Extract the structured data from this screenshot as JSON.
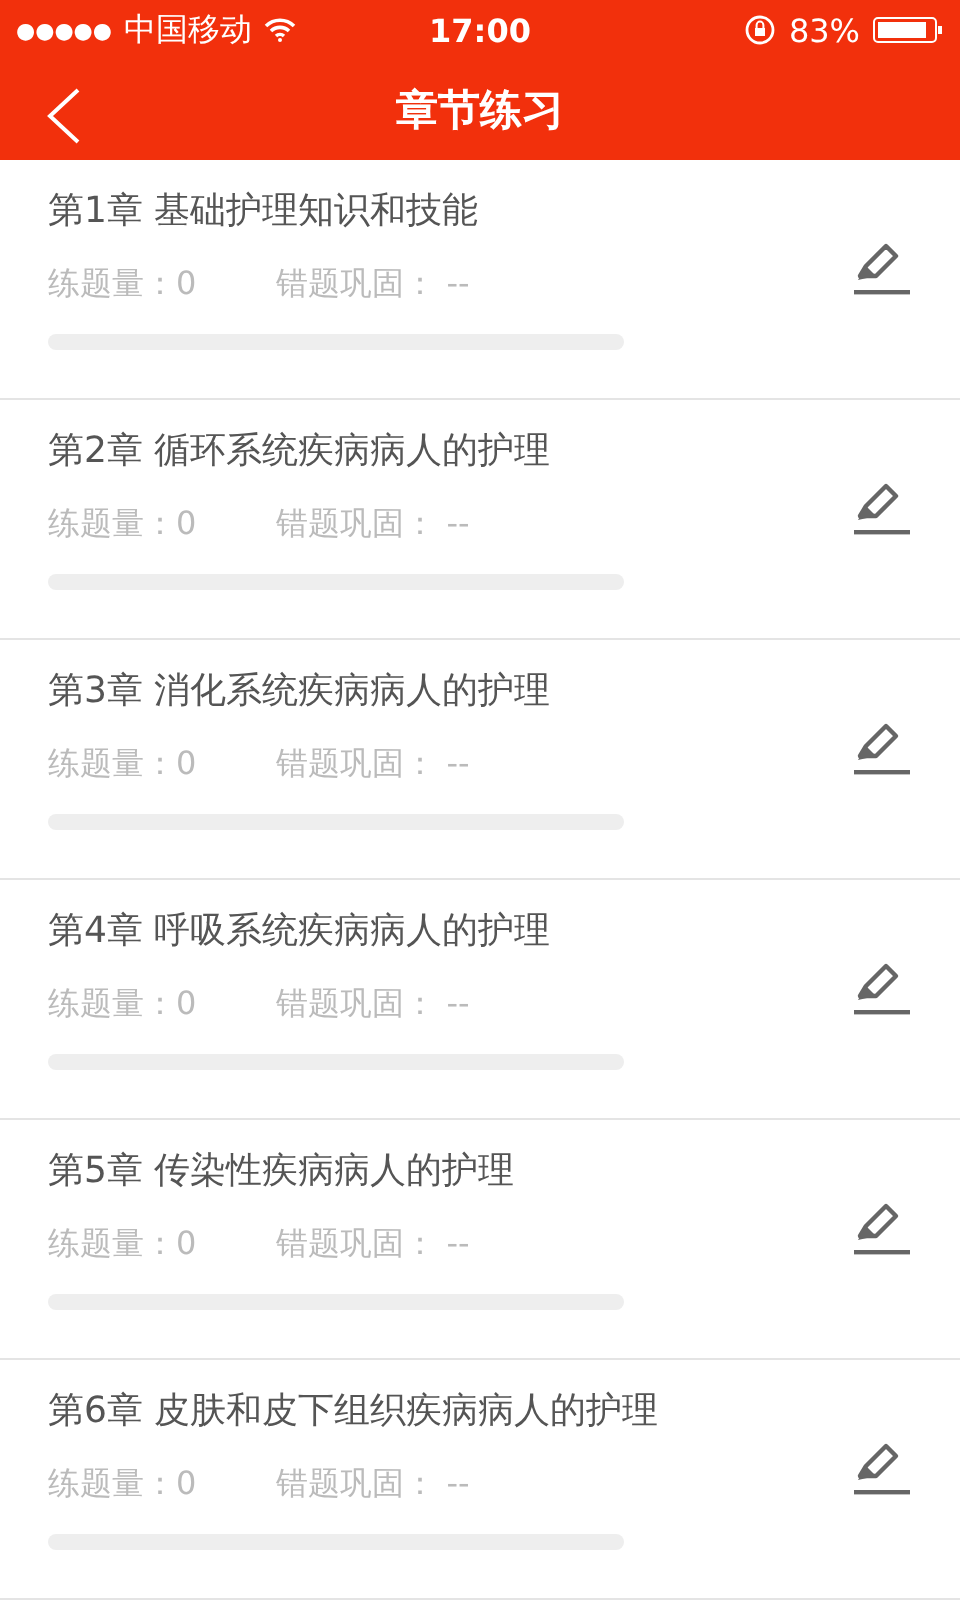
{
  "status_bar": {
    "signal_dots": "●●●●●",
    "carrier": "中国移动",
    "time": "17:00",
    "battery": "83%"
  },
  "nav": {
    "title": "章节练习"
  },
  "chapters": [
    {
      "title": "第1章 基础护理知识和技能",
      "practice_count": "练题量：0",
      "wrong_review": "错题巩固： --",
      "level": 0
    },
    {
      "title": "第2章 循环系统疾病病人的护理",
      "practice_count": "练题量：0",
      "wrong_review": "错题巩固： --",
      "level": 0
    },
    {
      "title": "第3章 消化系统疾病病人的护理",
      "practice_count": "练题量：0",
      "wrong_review": "错题巩固： --",
      "level": 0
    },
    {
      "title": "第4章 呼吸系统疾病病人的护理",
      "practice_count": "练题量：0",
      "wrong_review": "错题巩固： --",
      "level": 0
    },
    {
      "title": "第5章 传染性疾病病人的护理",
      "practice_count": "练题量：0",
      "wrong_review": "错题巩固： --",
      "level": 0
    },
    {
      "title": "第6章 皮肤和皮下组织疾病病人的护理",
      "practice_count": "练题量：0",
      "wrong_review": "错题巩固： --",
      "level": 0
    }
  ]
}
